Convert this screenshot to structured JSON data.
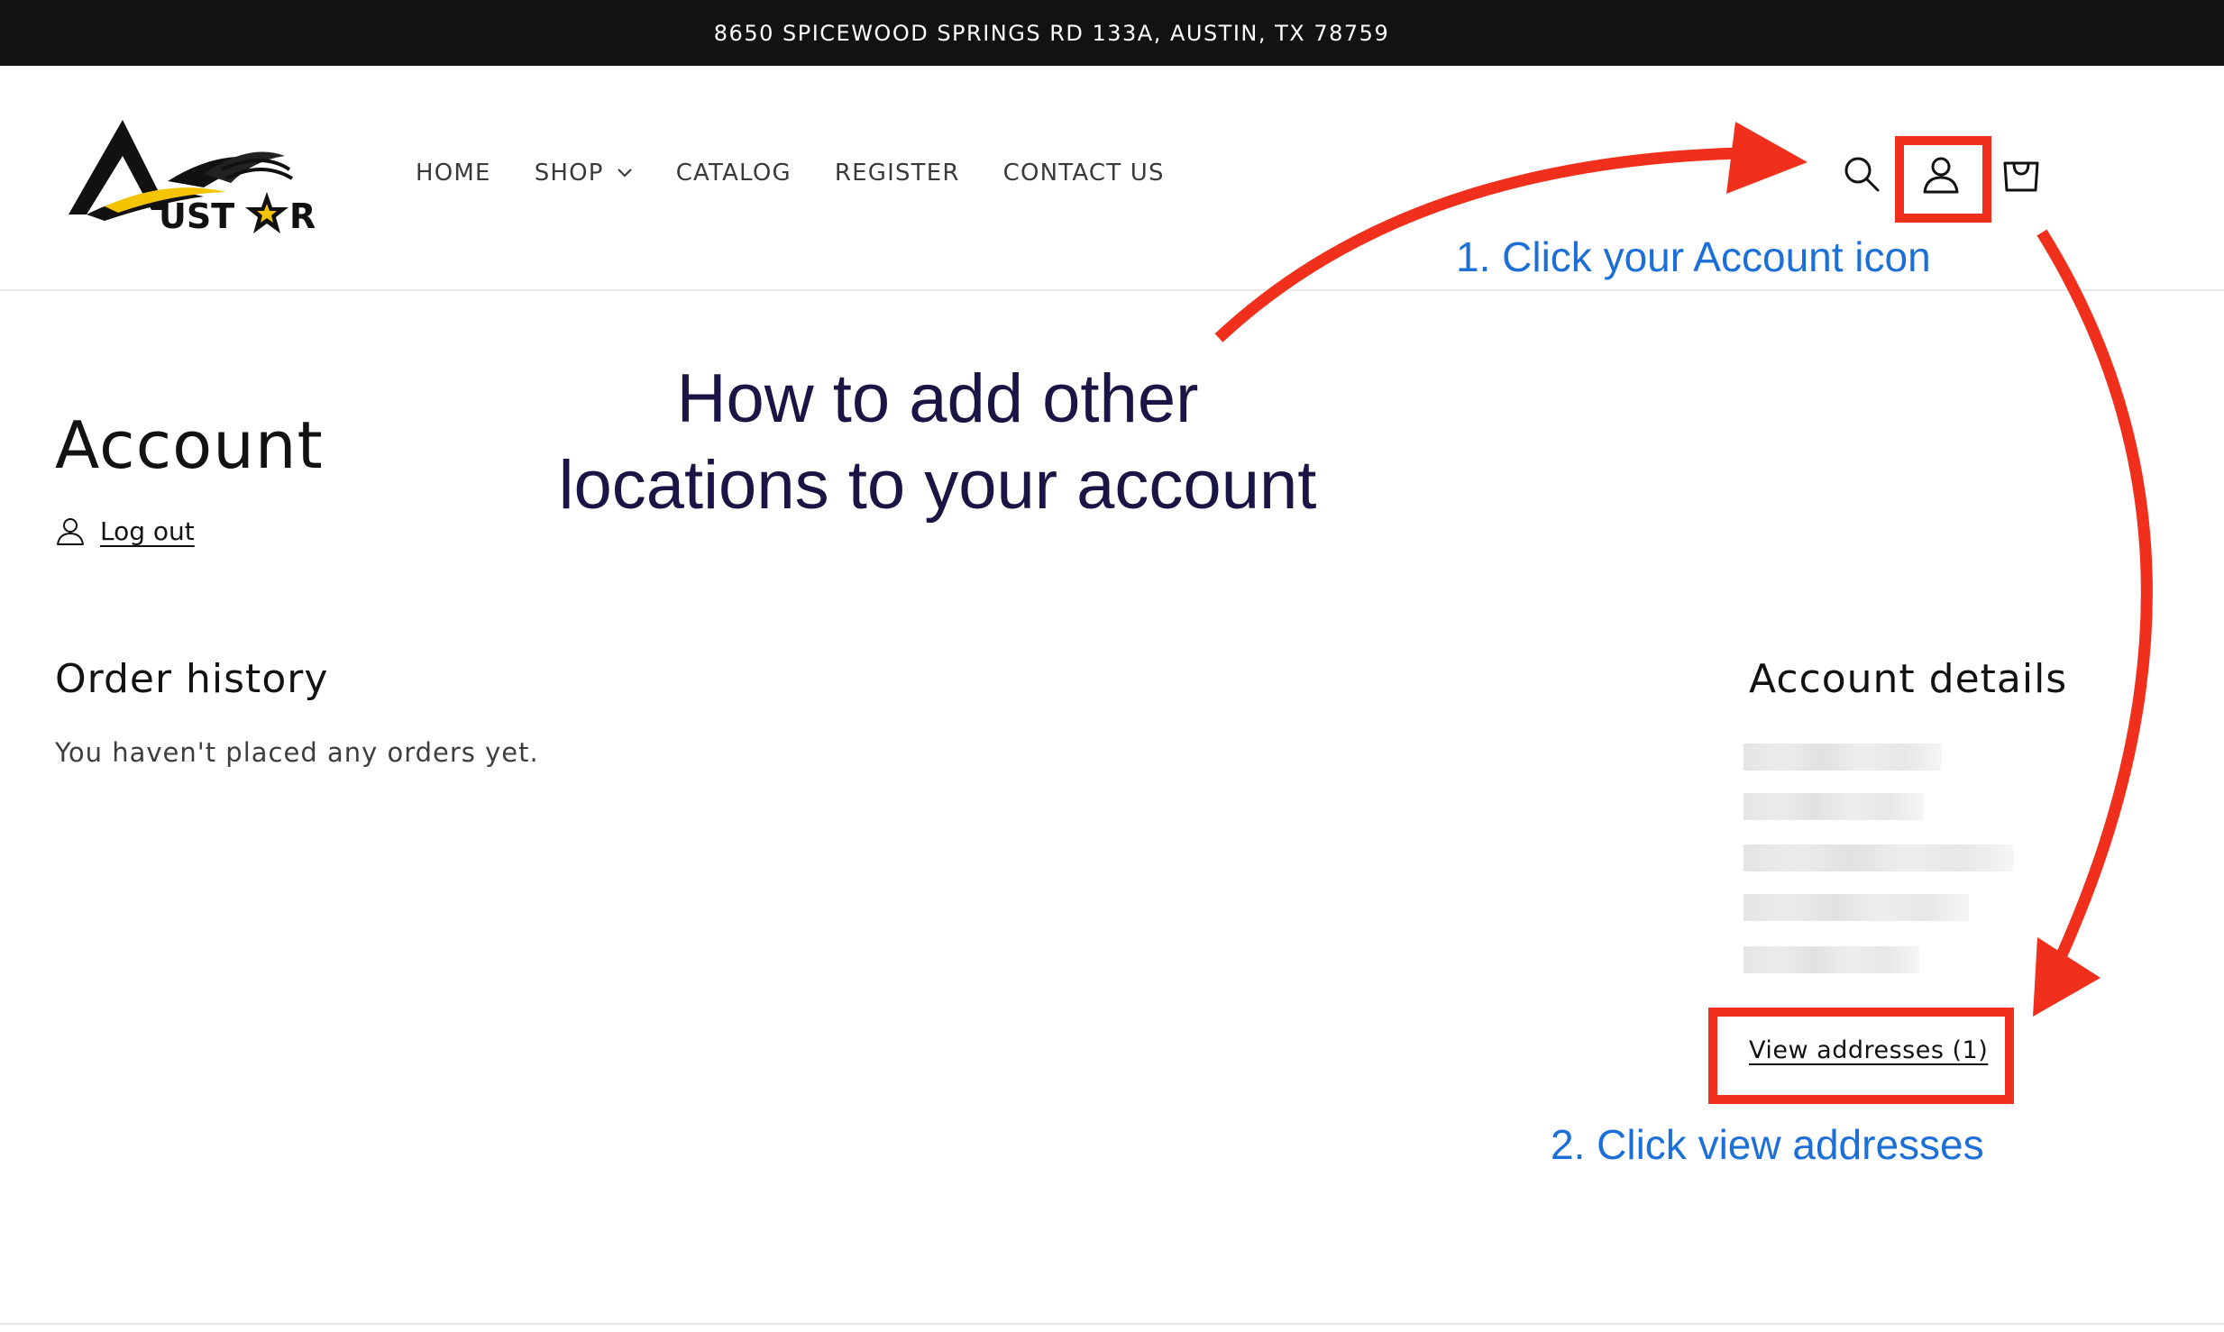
{
  "announcement": "8650 SPICEWOOD SPRINGS RD 133A, AUSTIN, TX 78759",
  "logo": {
    "text": "AUSTAR"
  },
  "nav": {
    "items": [
      {
        "label": "HOME"
      },
      {
        "label": "SHOP",
        "has_dropdown": true
      },
      {
        "label": "CATALOG"
      },
      {
        "label": "REGISTER"
      },
      {
        "label": "CONTACT US"
      }
    ]
  },
  "header_icons": [
    "search-icon",
    "account-icon",
    "cart-icon"
  ],
  "account": {
    "title": "Account",
    "logout_label": "Log out"
  },
  "order_history": {
    "title": "Order history",
    "empty_message": "You haven't placed any orders yet."
  },
  "account_details": {
    "title": "Account details",
    "view_addresses_label": "View addresses (1)"
  },
  "annotations": {
    "title_line1": "How to add other",
    "title_line2": "locations to your account",
    "step1": "1. Click your Account icon",
    "step2": "2. Click view addresses"
  },
  "colors": {
    "announcement_bg": "#121212",
    "annotation_red": "#f0301c",
    "annotation_blue": "#1d6fd8",
    "annotation_title": "#1b1545"
  }
}
